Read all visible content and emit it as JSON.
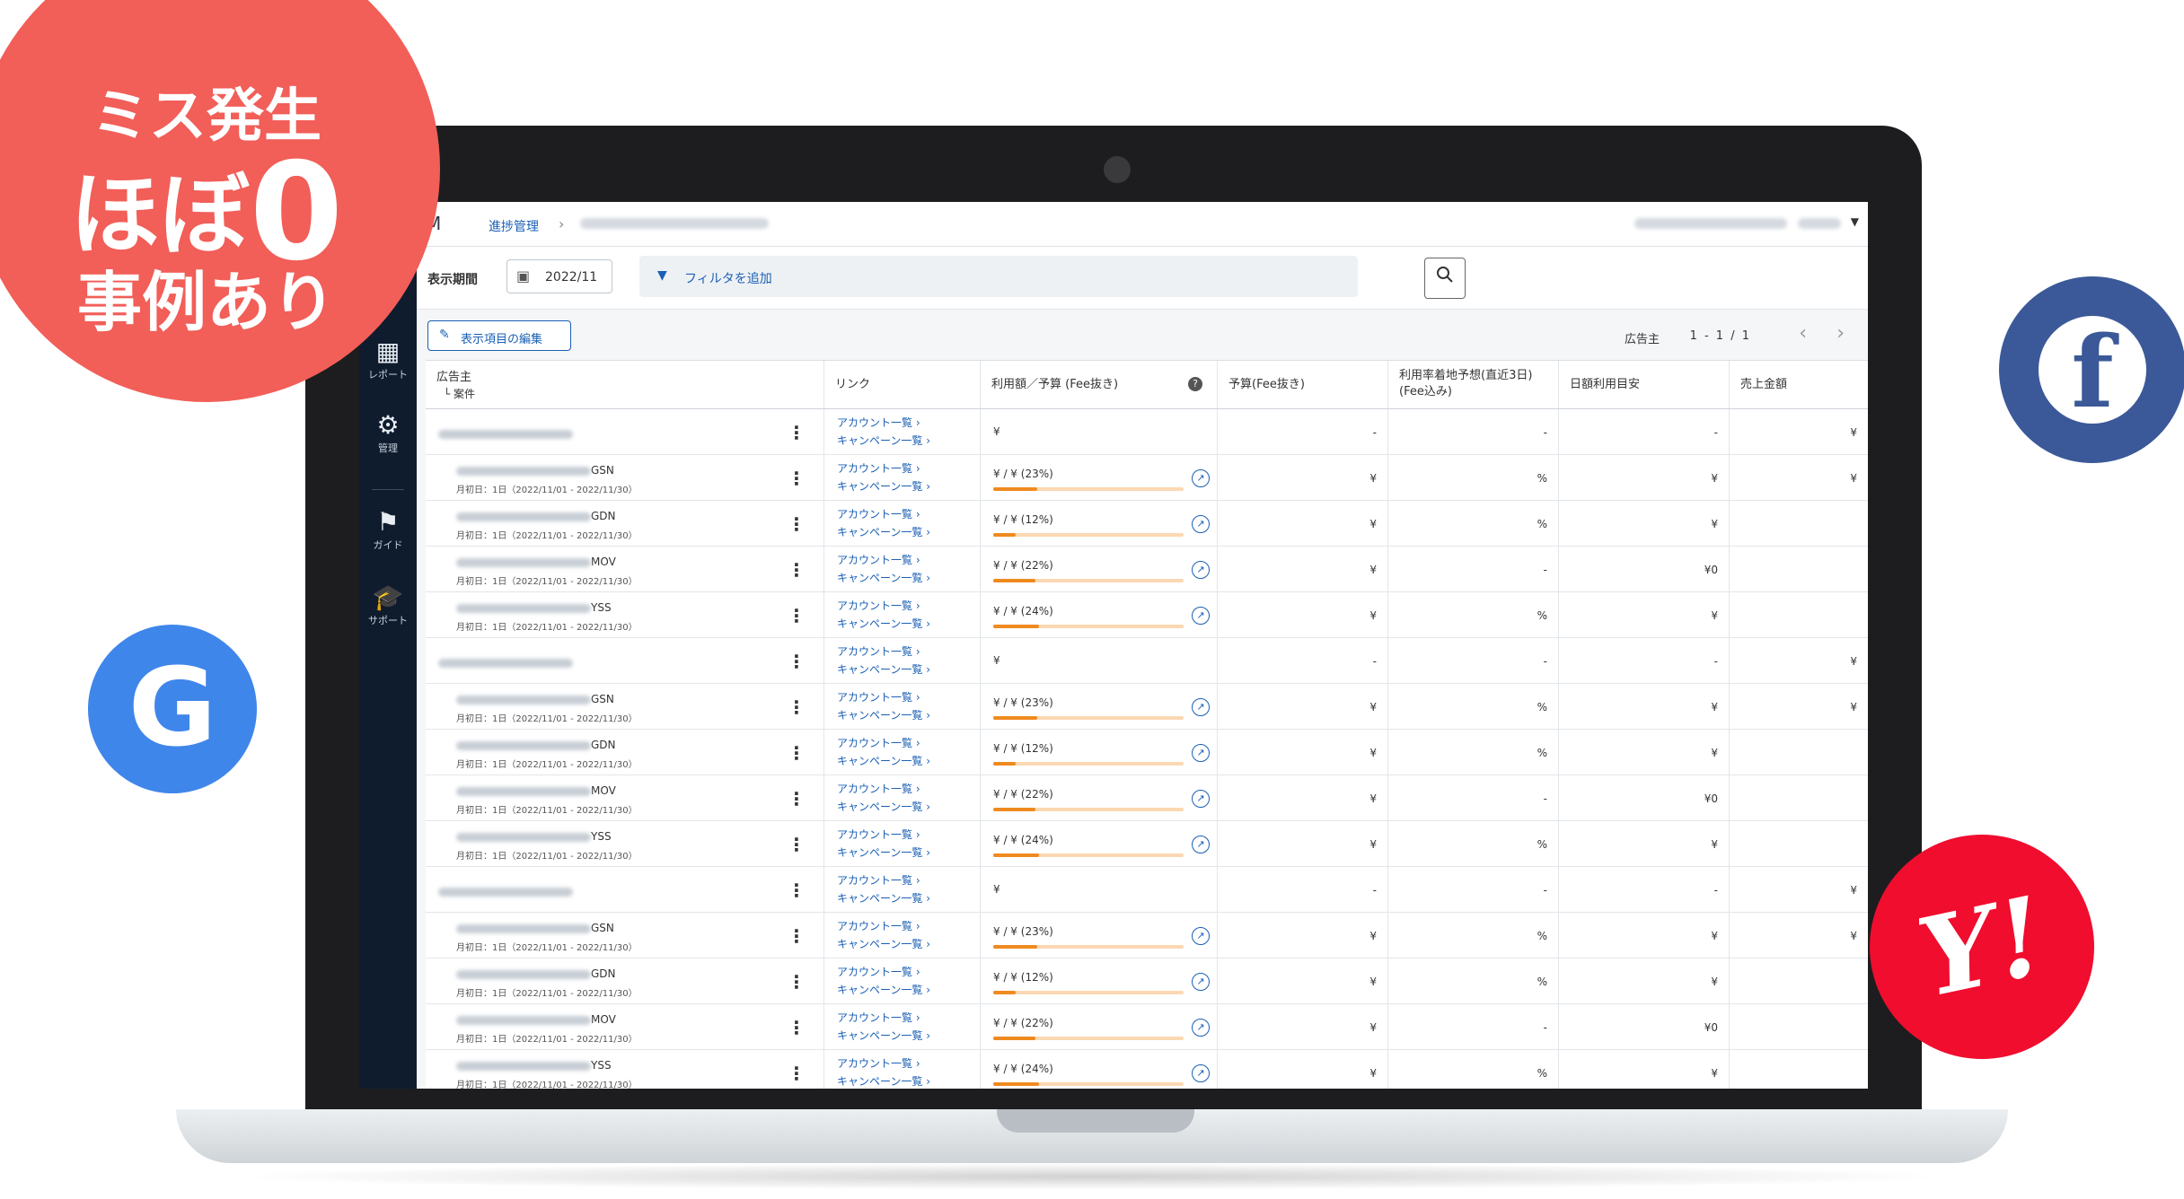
{
  "badge": {
    "line1": "ミス発生",
    "line2_text": "ほぼ",
    "line2_zero": "0",
    "line3": "事例あり"
  },
  "logos": {
    "facebook": "f",
    "google": "G",
    "yahoo": "Y!"
  },
  "app": {
    "logo": "M",
    "breadcrumb": "進捗管理",
    "sidebar": [
      {
        "label": "レポート",
        "icon": "report-icon"
      },
      {
        "label": "管理",
        "icon": "gear-icon"
      },
      {
        "label": "ガイド",
        "icon": "flag-icon"
      },
      {
        "label": "サポート",
        "icon": "graduation-cap-icon"
      }
    ],
    "filter": {
      "period_label": "表示期間",
      "period_value": "2022/11",
      "add_filter": "フィルタを追加"
    },
    "toolbar": {
      "edit_columns": "表示項目の編集",
      "pager_label": "広告主",
      "pager_range": "1 - 1 / 1"
    },
    "columns": {
      "advertiser": "広告主",
      "project": "└ 案件",
      "link": "リンク",
      "usage": "利用額／予算 (Fee抜き)",
      "budget": "予算(Fee抜き)",
      "rate": "利用率着地予想(直近3日)\n(Fee込み)",
      "daily": "日額利用目安",
      "sales": "売上金額"
    },
    "links": {
      "accounts": "アカウント一覧 ›",
      "campaigns": "キャンペーン一覧 ›"
    },
    "period_prefix": "月初日：1日（2022/11/01 - 2022/11/30）",
    "rows": [
      {
        "type": "group",
        "usage": "¥",
        "budget": "-",
        "rate": "-",
        "daily": "-",
        "sales": "¥"
      },
      {
        "type": "item",
        "suffix": "GSN",
        "usage": "¥ / ¥ (23%)",
        "pct": 23,
        "budget": "¥",
        "rate": "%",
        "daily": "¥",
        "sales": "¥"
      },
      {
        "type": "item",
        "suffix": "GDN",
        "usage": "¥ / ¥ (12%)",
        "pct": 12,
        "budget": "¥",
        "rate": "%",
        "daily": "¥",
        "sales": ""
      },
      {
        "type": "item",
        "suffix": "MOV",
        "usage": "¥ / ¥ (22%)",
        "pct": 22,
        "budget": "¥",
        "rate": "-",
        "daily": "¥0",
        "sales": ""
      },
      {
        "type": "item",
        "suffix": "YSS",
        "usage": "¥ / ¥ (24%)",
        "pct": 24,
        "budget": "¥",
        "rate": "%",
        "daily": "¥",
        "sales": ""
      },
      {
        "type": "group",
        "usage": "¥",
        "budget": "-",
        "rate": "-",
        "daily": "-",
        "sales": "¥"
      },
      {
        "type": "item",
        "suffix": "GSN",
        "usage": "¥ / ¥ (23%)",
        "pct": 23,
        "budget": "¥",
        "rate": "%",
        "daily": "¥",
        "sales": "¥"
      },
      {
        "type": "item",
        "suffix": "GDN",
        "usage": "¥ / ¥ (12%)",
        "pct": 12,
        "budget": "¥",
        "rate": "%",
        "daily": "¥",
        "sales": ""
      },
      {
        "type": "item",
        "suffix": "MOV",
        "usage": "¥ / ¥ (22%)",
        "pct": 22,
        "budget": "¥",
        "rate": "-",
        "daily": "¥0",
        "sales": ""
      },
      {
        "type": "item",
        "suffix": "YSS",
        "usage": "¥ / ¥ (24%)",
        "pct": 24,
        "budget": "¥",
        "rate": "%",
        "daily": "¥",
        "sales": ""
      },
      {
        "type": "group",
        "usage": "¥",
        "budget": "-",
        "rate": "-",
        "daily": "-",
        "sales": "¥"
      },
      {
        "type": "item",
        "suffix": "GSN",
        "usage": "¥ / ¥ (23%)",
        "pct": 23,
        "budget": "¥",
        "rate": "%",
        "daily": "¥",
        "sales": "¥"
      },
      {
        "type": "item",
        "suffix": "GDN",
        "usage": "¥ / ¥ (12%)",
        "pct": 12,
        "budget": "¥",
        "rate": "%",
        "daily": "¥",
        "sales": ""
      },
      {
        "type": "item",
        "suffix": "MOV",
        "usage": "¥ / ¥ (22%)",
        "pct": 22,
        "budget": "¥",
        "rate": "-",
        "daily": "¥0",
        "sales": ""
      },
      {
        "type": "item",
        "suffix": "YSS",
        "usage": "¥ / ¥ (24%)",
        "pct": 24,
        "budget": "¥",
        "rate": "%",
        "daily": "¥",
        "sales": ""
      }
    ]
  }
}
